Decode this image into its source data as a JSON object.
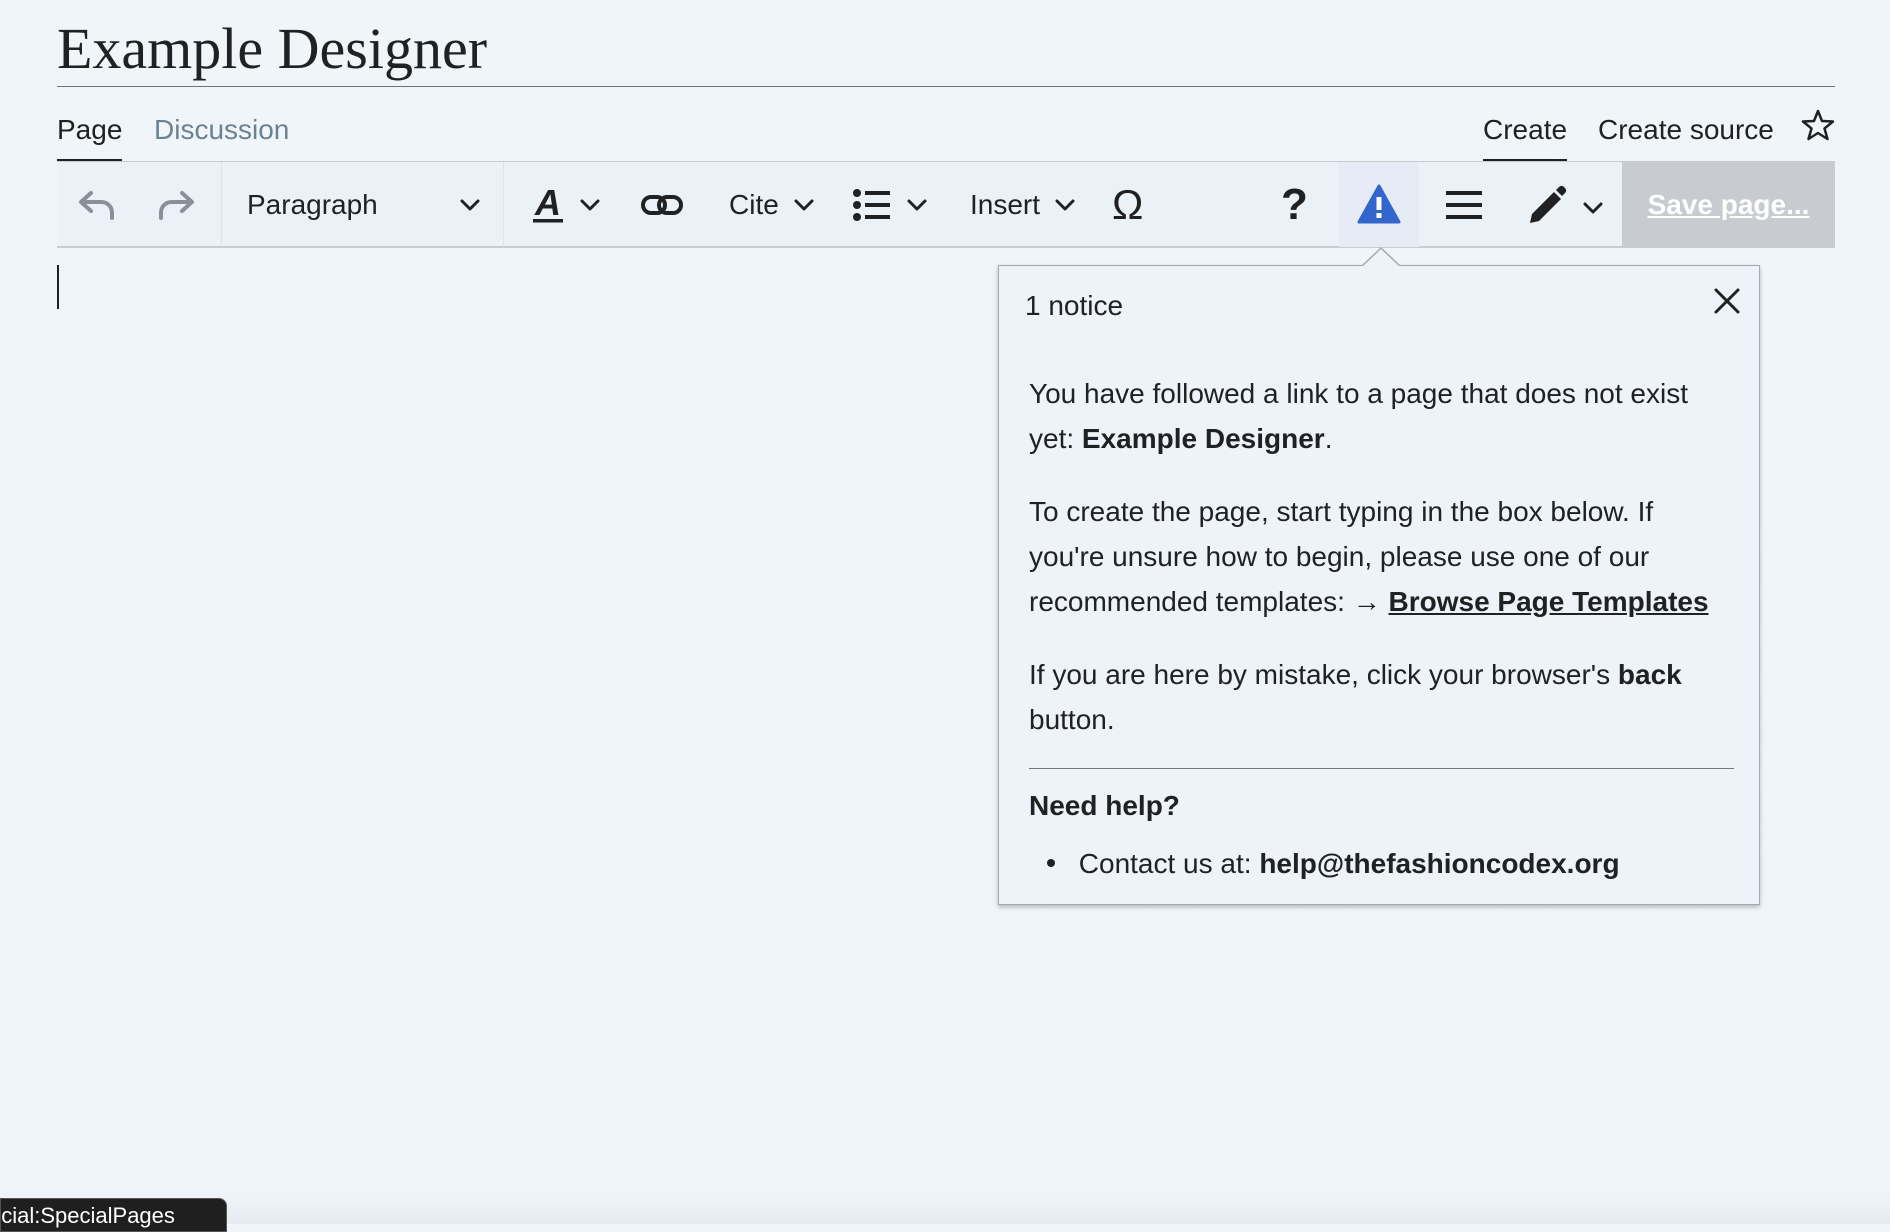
{
  "page": {
    "title": "Example Designer"
  },
  "tabs": {
    "page": "Page",
    "discussion": "Discussion",
    "create": "Create",
    "create_source": "Create source"
  },
  "toolbar": {
    "undo_icon": "undo-icon",
    "redo_icon": "redo-icon",
    "paragraph": "Paragraph",
    "text_style_icon": "text-style-icon",
    "link_icon": "link-icon",
    "cite": "Cite",
    "list_icon": "bulleted-list-icon",
    "insert": "Insert",
    "special_chars": "Ω",
    "help": "?",
    "notices_icon": "warning-icon",
    "menu_icon": "hamburger-menu-icon",
    "edit_mode_icon": "pencil-icon",
    "save": "Save page..."
  },
  "notice": {
    "header": "1 notice",
    "p1_text": "You have followed a link to a page that does not exist yet:",
    "p1_bold": "Example Designer",
    "p1_end": ".",
    "p2_text": "To create the page, start typing in the box below. If you're unsure how to begin, please use one of our recommended templates: →",
    "p2_link": "Browse Page Templates",
    "p3_text": "If you are here by mistake, click your browser's",
    "p3_bold": "back",
    "p3_end": "button.",
    "help_heading": "Need help?",
    "contact_label": "Contact us at:",
    "contact_email": "help@thefashioncodex.org"
  },
  "status_bar": {
    "url": "ecial:SpecialPages"
  },
  "colors": {
    "accent": "#3366cc",
    "save_disabled_bg": "#c8ccd1",
    "text": "#202122",
    "muted_tab": "#6c8290"
  }
}
